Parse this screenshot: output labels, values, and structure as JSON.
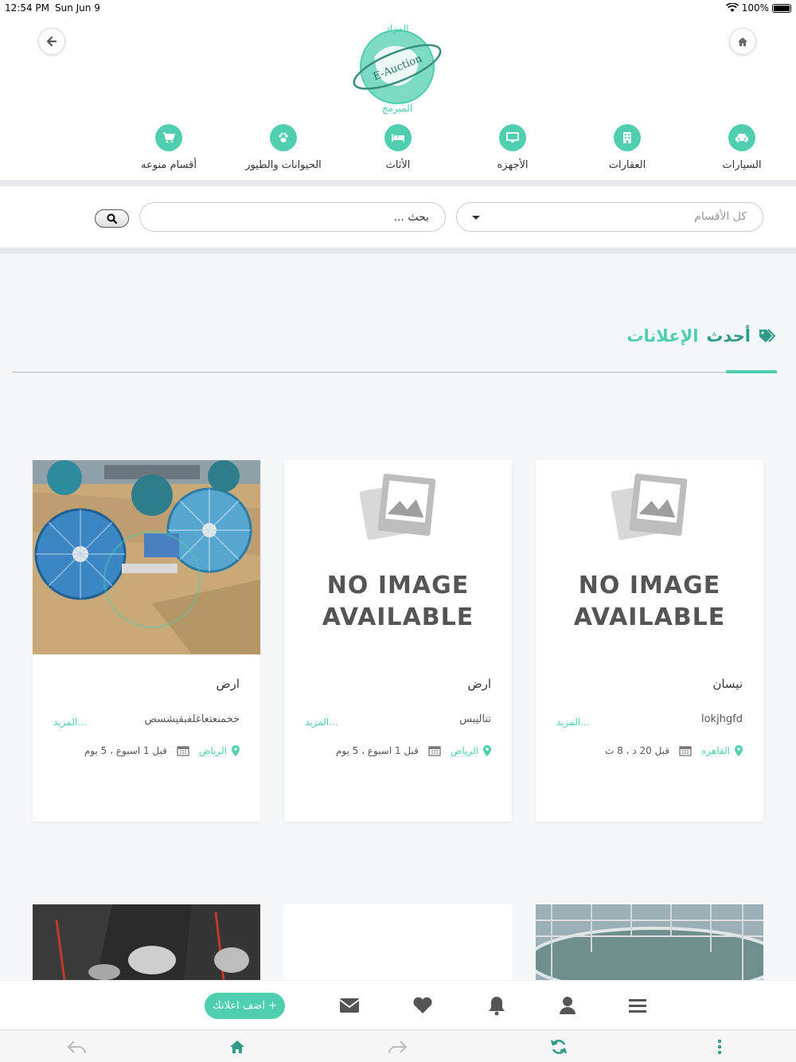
{
  "status_bar": {
    "time": "12:54 PM",
    "date": "Sun Jun 9",
    "battery": "100%"
  },
  "header": {
    "back_icon": "arrow-left-icon",
    "home_icon": "home-icon",
    "logo_text": "E-Auction",
    "logo_arabic": "المزاد المبرمج"
  },
  "categories": [
    {
      "label": "السيارات",
      "icon": "car-icon"
    },
    {
      "label": "العقارات",
      "icon": "building-icon"
    },
    {
      "label": "الأجهزه",
      "icon": "desktop-icon"
    },
    {
      "label": "الأثاث",
      "icon": "bed-icon"
    },
    {
      "label": "الحيوانات والطيور",
      "icon": "paw-icon"
    },
    {
      "label": "أقسام منوعه",
      "icon": "cart-icon"
    }
  ],
  "search": {
    "category_placeholder": "كل الأقسام",
    "input_placeholder": "بحث ...",
    "button_icon": "search-icon"
  },
  "section": {
    "title_part1": "أحدث",
    "title_part2": "الإعلانات",
    "icon": "tags-icon"
  },
  "listings": [
    {
      "name": "نيسان",
      "description": "lokjhgfd",
      "more": "المزيد...",
      "location": "القاهره",
      "time": "قبل 20 د ، 8 ث",
      "image": "no-image"
    },
    {
      "name": "ارض",
      "description": "تتاليبس",
      "more": "المزيد...",
      "location": "الرياض",
      "time": "قبل 1 اسبوع ، 5 يوم",
      "image": "no-image"
    },
    {
      "name": "ارض",
      "description": "خخمنعتعاغلفبقيشسص",
      "more": "المزيد...",
      "location": "الرياض",
      "time": "قبل 1 اسبوع ، 5 يوم",
      "image": "photo-water-plant"
    }
  ],
  "no_image": {
    "line1": "NO IMAGE",
    "line2": "AVAILABLE"
  },
  "bottom_bar": {
    "add_button": "+ اضف اعلانك",
    "icons": [
      "envelope-icon",
      "heart-icon",
      "bell-icon",
      "user-icon",
      "menu-icon"
    ]
  },
  "browser_bar": {
    "icons": [
      "back-arrow-icon",
      "home-icon",
      "forward-arrow-icon",
      "refresh-icon",
      "more-icon"
    ]
  },
  "colors": {
    "accent": "#4fcfb0",
    "accent_dark": "#2f9a86"
  }
}
